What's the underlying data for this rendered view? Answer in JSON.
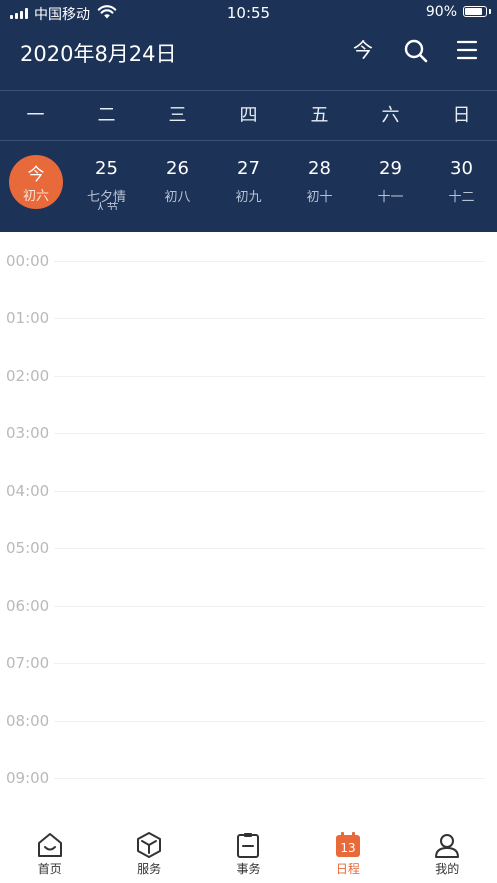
{
  "status_bar": {
    "carrier": "中国移动",
    "time": "10:55",
    "battery": "90%",
    "battery_level": 0.9
  },
  "header": {
    "title": "2020年8月24日",
    "today_label": "今",
    "search_icon": "search-icon",
    "menu_icon": "menu-icon"
  },
  "weekdays": [
    "一",
    "二",
    "三",
    "四",
    "五",
    "六",
    "日"
  ],
  "days": [
    {
      "num": "今",
      "lunar": "初六",
      "today": true
    },
    {
      "num": "25",
      "lunar": "七夕情",
      "extra": "人节"
    },
    {
      "num": "26",
      "lunar": "初八"
    },
    {
      "num": "27",
      "lunar": "初九"
    },
    {
      "num": "28",
      "lunar": "初十"
    },
    {
      "num": "29",
      "lunar": "十一"
    },
    {
      "num": "30",
      "lunar": "十二"
    }
  ],
  "time_slots": [
    "00:00",
    "01:00",
    "02:00",
    "03:00",
    "04:00",
    "05:00",
    "06:00",
    "07:00",
    "08:00",
    "09:00"
  ],
  "tabs": [
    {
      "label": "首页",
      "icon": "home-icon",
      "active": false
    },
    {
      "label": "服务",
      "icon": "cube-icon",
      "active": false
    },
    {
      "label": "事务",
      "icon": "clipboard-icon",
      "active": false
    },
    {
      "label": "日程",
      "icon": "calendar-icon",
      "active": true,
      "icon_text": "13"
    },
    {
      "label": "我的",
      "icon": "user-icon",
      "active": false
    }
  ],
  "colors": {
    "header_bg": "#1c3257",
    "accent": "#e8693a",
    "tab_icon": "#333333"
  }
}
